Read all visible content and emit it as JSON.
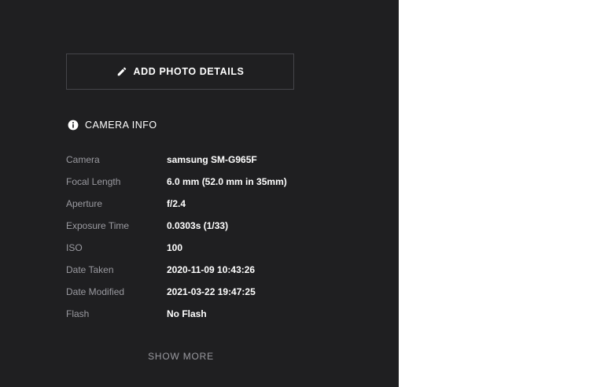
{
  "add_button": {
    "label": "ADD PHOTO DETAILS",
    "icon": "pencil-icon"
  },
  "camera_info": {
    "title": "CAMERA INFO",
    "icon": "info-circle-icon",
    "rows": [
      {
        "label": "Camera",
        "value": "samsung SM-G965F"
      },
      {
        "label": "Focal Length",
        "value": "6.0 mm (52.0 mm in 35mm)"
      },
      {
        "label": "Aperture",
        "value": "f/2.4"
      },
      {
        "label": "Exposure Time",
        "value": "0.0303s (1/33)"
      },
      {
        "label": "ISO",
        "value": "100"
      },
      {
        "label": "Date Taken",
        "value": "2020-11-09 10:43:26"
      },
      {
        "label": "Date Modified",
        "value": "2021-03-22 19:47:25"
      },
      {
        "label": "Flash",
        "value": "No Flash"
      }
    ]
  },
  "show_more": {
    "label": "SHOW MORE"
  },
  "colors": {
    "panel_bg": "#1f1f21",
    "label_gray": "#9a9aa0",
    "value_white": "#ffffff",
    "border": "#45454a"
  }
}
